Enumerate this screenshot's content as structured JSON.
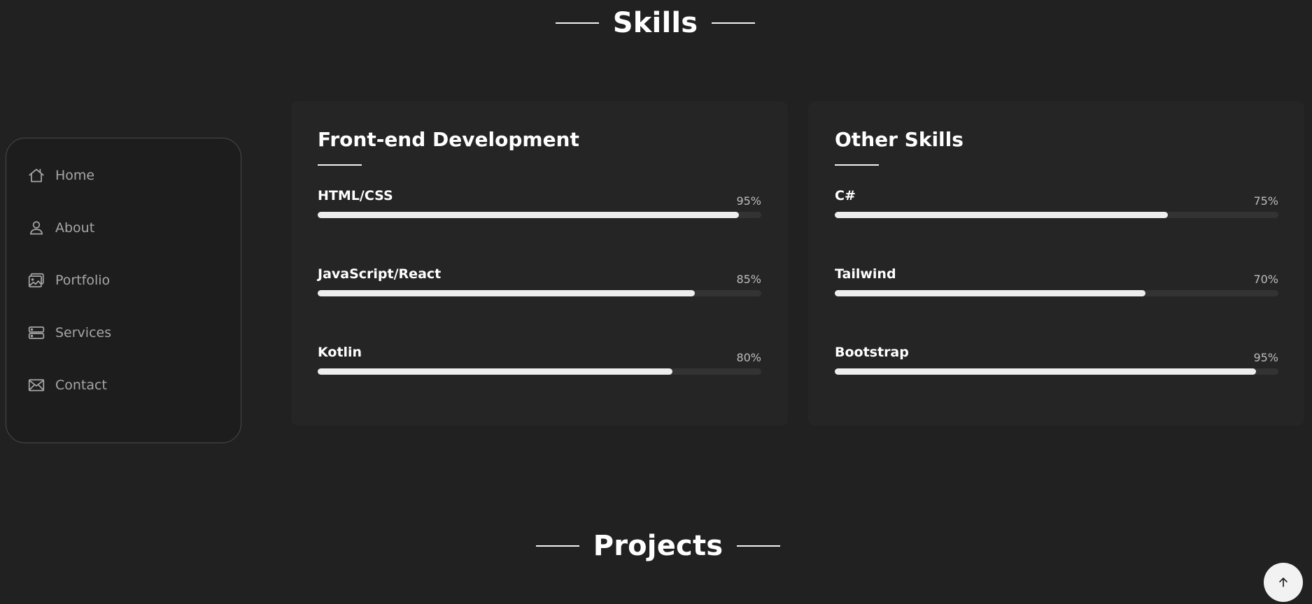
{
  "sections": {
    "skills_title": "Skills",
    "projects_title": "Projects"
  },
  "nav": {
    "items": [
      {
        "label": "Home",
        "icon": "home-icon"
      },
      {
        "label": "About",
        "icon": "user-icon"
      },
      {
        "label": "Portfolio",
        "icon": "image-icon"
      },
      {
        "label": "Services",
        "icon": "server-icon"
      },
      {
        "label": "Contact",
        "icon": "mail-icon"
      }
    ]
  },
  "skills": {
    "frontend": {
      "title": "Front-end Development",
      "items": [
        {
          "name": "HTML/CSS",
          "percent_label": "95%",
          "level": 0.95
        },
        {
          "name": "JavaScript/React",
          "percent_label": "85%",
          "level": 0.85
        },
        {
          "name": "Kotlin",
          "percent_label": "80%",
          "level": 0.8
        }
      ]
    },
    "other": {
      "title": "Other Skills",
      "items": [
        {
          "name": "C#",
          "percent_label": "75%",
          "level": 0.75
        },
        {
          "name": "Tailwind",
          "percent_label": "70%",
          "level": 0.7
        },
        {
          "name": "Bootstrap",
          "percent_label": "95%",
          "level": 0.95
        }
      ]
    }
  },
  "back_to_top": {
    "icon": "arrow-up-icon"
  },
  "colors": {
    "background": "#212121",
    "card": "#252525",
    "bar_fill": "#eeeeee",
    "bar_track": "#333333",
    "nav_text": "#a6a6a6"
  }
}
